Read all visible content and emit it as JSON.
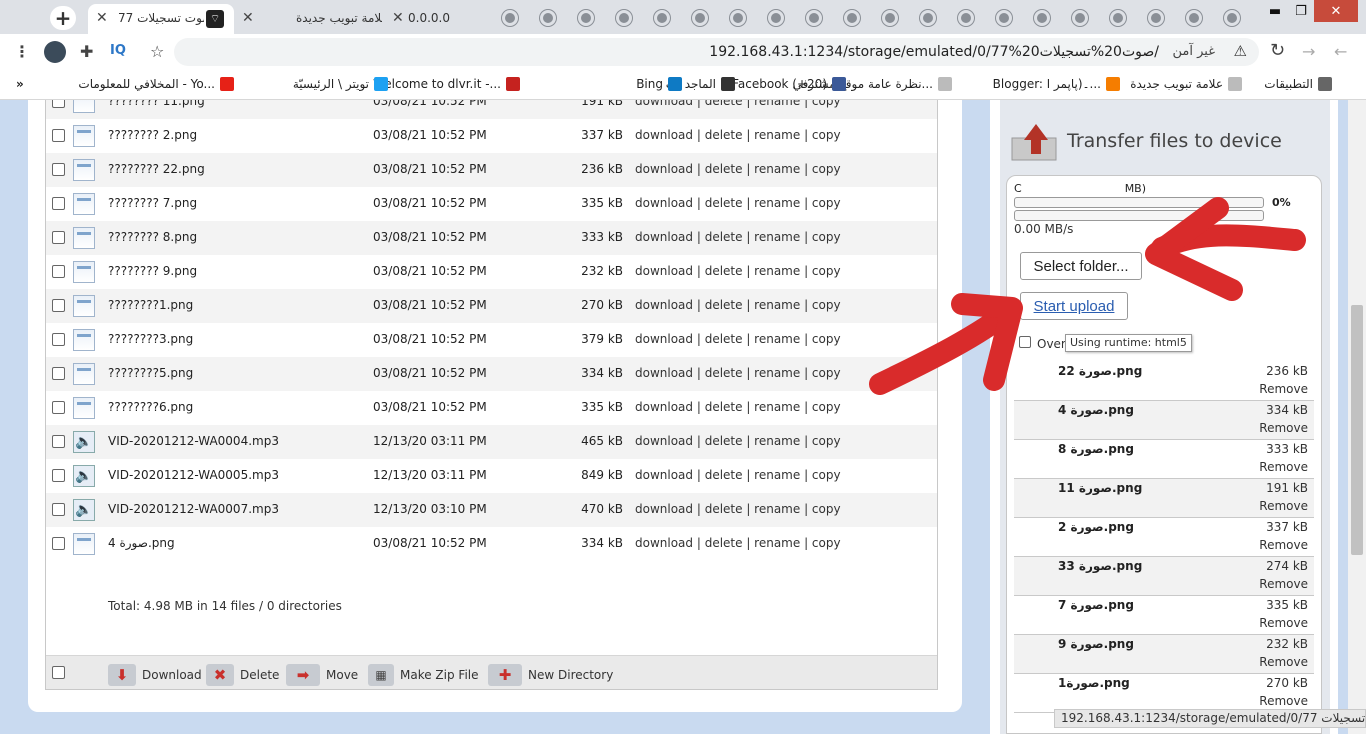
{
  "browser": {
    "tabs": [
      {
        "title": "77 صوت تسجيلات",
        "active": true
      },
      {
        "title": "علامة تبويب جديدة",
        "active": false
      },
      {
        "title": "0.0.0.0",
        "active": false
      }
    ],
    "url": "192.168.43.1:1234/storage/emulated/0/77%صوت20%تسجيلات20/",
    "security_label": "غير آمن",
    "extension_label": "IQ"
  },
  "bookmarks": [
    {
      "label": "التطبيقات",
      "icon": "apps-icon"
    },
    {
      "label": "علامة تبويب جديدة",
      "icon": "page-icon"
    },
    {
      "label": "Blogger: ۔(ﭘﺎﭘﻤﺮ ﺍ...",
      "icon": "blogger-icon"
    },
    {
      "label": "نظرة عامة   موقع مشترفي...",
      "icon": "page-icon"
    },
    {
      "label": "Facebook (+20)",
      "icon": "facebook-icon"
    },
    {
      "label": "الماجد نت",
      "icon": "globe-icon"
    },
    {
      "label": "Bing",
      "icon": "bing-icon"
    },
    {
      "label": "Welcome to dlvr.it -...",
      "icon": "gmail-icon"
    },
    {
      "label": "تويتر \\ الرئيسيّة",
      "icon": "twitter-icon"
    },
    {
      "label": "المخلافي للمعلومات - Yo...",
      "icon": "youtube-icon"
    }
  ],
  "files": {
    "partial_row": {
      "name": "???????? 11.png",
      "date": "03/08/21 10:52 PM",
      "size": "191 kB",
      "actions": "download | delete | rename | copy"
    },
    "rows": [
      {
        "name": "???????? 2.png",
        "date": "03/08/21 10:52 PM",
        "size": "337 kB",
        "actions": "download | delete | rename | copy",
        "type": "img"
      },
      {
        "name": "???????? 22.png",
        "date": "03/08/21 10:52 PM",
        "size": "236 kB",
        "actions": "download | delete | rename | copy",
        "type": "img"
      },
      {
        "name": "???????? 7.png",
        "date": "03/08/21 10:52 PM",
        "size": "335 kB",
        "actions": "download | delete | rename | copy",
        "type": "img"
      },
      {
        "name": "???????? 8.png",
        "date": "03/08/21 10:52 PM",
        "size": "333 kB",
        "actions": "download | delete | rename | copy",
        "type": "img"
      },
      {
        "name": "???????? 9.png",
        "date": "03/08/21 10:52 PM",
        "size": "232 kB",
        "actions": "download | delete | rename | copy",
        "type": "img"
      },
      {
        "name": "????????1.png",
        "date": "03/08/21 10:52 PM",
        "size": "270 kB",
        "actions": "download | delete | rename | copy",
        "type": "img"
      },
      {
        "name": "????????3.png",
        "date": "03/08/21 10:52 PM",
        "size": "379 kB",
        "actions": "download | delete | rename | copy",
        "type": "img"
      },
      {
        "name": "????????5.png",
        "date": "03/08/21 10:52 PM",
        "size": "334 kB",
        "actions": "download | delete | rename | copy",
        "type": "img"
      },
      {
        "name": "????????6.png",
        "date": "03/08/21 10:52 PM",
        "size": "335 kB",
        "actions": "download | delete | rename | copy",
        "type": "img"
      },
      {
        "name": "VID-20201212-WA0004.mp3",
        "date": "12/13/20 03:11 PM",
        "size": "465 kB",
        "actions": "download | delete | rename | copy",
        "type": "aud"
      },
      {
        "name": "VID-20201212-WA0005.mp3",
        "date": "12/13/20 03:11 PM",
        "size": "849 kB",
        "actions": "download | delete | rename | copy",
        "type": "aud"
      },
      {
        "name": "VID-20201212-WA0007.mp3",
        "date": "12/13/20 03:10 PM",
        "size": "470 kB",
        "actions": "download | delete | rename | copy",
        "type": "aud"
      },
      {
        "name": "صورة 4.png",
        "date": "03/08/21 10:52 PM",
        "size": "334 kB",
        "actions": "download | delete | rename | copy",
        "type": "img"
      }
    ],
    "total": "Total: 4.98 MB in 14 files / 0 directories"
  },
  "toolbar": {
    "download": "Download",
    "delete": "Delete",
    "move": "Move",
    "zip": "Make Zip File",
    "new_dir": "New Directory"
  },
  "upload": {
    "title": "Transfer files to device",
    "info_left": "C",
    "info_right": "MB)",
    "percent": "0%",
    "progress": 0,
    "speed": "0.00 MB/s",
    "select_label": "Select folder...",
    "start_label": "Start upload",
    "overwrite_label": "Over",
    "tooltip": "Using runtime: html5",
    "queue": [
      {
        "name": "صورة 22.png",
        "size": "236 kB",
        "remove": "Remove"
      },
      {
        "name": "صورة 4.png",
        "size": "334 kB",
        "remove": "Remove"
      },
      {
        "name": "صورة 8.png",
        "size": "333 kB",
        "remove": "Remove"
      },
      {
        "name": "صورة 11.png",
        "size": "191 kB",
        "remove": "Remove"
      },
      {
        "name": "صورة 2.png",
        "size": "337 kB",
        "remove": "Remove"
      },
      {
        "name": "صورة 33.png",
        "size": "274 kB",
        "remove": "Remove"
      },
      {
        "name": "صورة 7.png",
        "size": "335 kB",
        "remove": "Remove"
      },
      {
        "name": "صورة 9.png",
        "size": "232 kB",
        "remove": "Remove"
      },
      {
        "name": "صورة1.png",
        "size": "270 kB",
        "remove": "Remove"
      }
    ]
  },
  "status_url": "192.168.43.1:1234/storage/emulated/0/77 صوت تسجيلات/#",
  "colors": {
    "annotation_red": "#d92b2b",
    "link_blue": "#2a5db0",
    "page_bg": "#c9daf0"
  }
}
